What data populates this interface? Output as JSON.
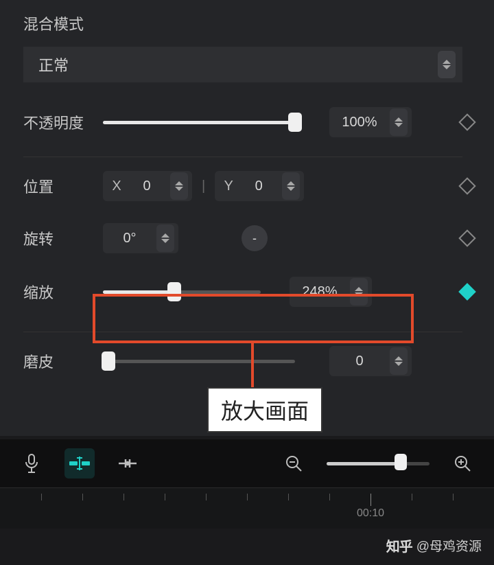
{
  "labels": {
    "blend_mode": "混合模式",
    "opacity": "不透明度",
    "position": "位置",
    "rotation": "旋转",
    "scale": "缩放",
    "smooth": "磨皮"
  },
  "blend_mode": {
    "selected": "正常"
  },
  "opacity": {
    "value": "100%",
    "percent": 100
  },
  "position": {
    "x_label": "X",
    "x_value": "0",
    "y_label": "Y",
    "y_value": "0"
  },
  "rotation": {
    "value": "0°",
    "extra": "-"
  },
  "scale": {
    "value": "248%",
    "percent": 40
  },
  "smooth": {
    "value": "0",
    "percent": 3
  },
  "annotation": {
    "text": "放大画面"
  },
  "toolbar": {
    "zoom_percent": 72
  },
  "timeline": {
    "label": "00:10"
  },
  "watermark": {
    "brand": "知乎",
    "author": "@母鸡资源"
  }
}
